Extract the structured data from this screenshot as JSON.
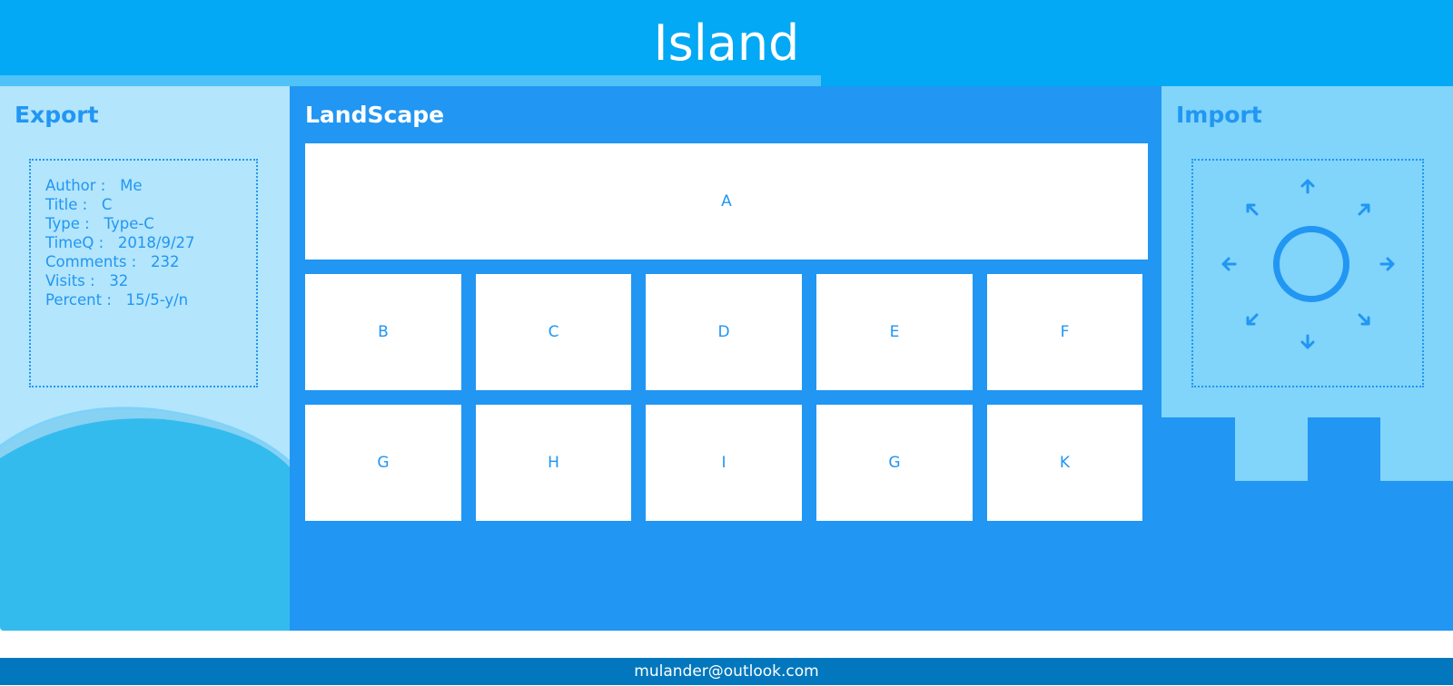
{
  "header": {
    "title": "Island"
  },
  "export": {
    "title": "Export",
    "info": [
      {
        "key": "Author",
        "value": "Me"
      },
      {
        "key": "Title",
        "value": "C"
      },
      {
        "key": "Type",
        "value": "Type-C"
      },
      {
        "key": "TimeQ",
        "value": "2018/9/27"
      },
      {
        "key": "Comments",
        "value": "232"
      },
      {
        "key": "Visits",
        "value": "32"
      },
      {
        "key": "Percent",
        "value": "15/5-y/n"
      }
    ]
  },
  "landscape": {
    "title": "LandScape",
    "tiles": [
      "A",
      "B",
      "C",
      "D",
      "E",
      "F",
      "G",
      "H",
      "I",
      "G",
      "K"
    ]
  },
  "import": {
    "title": "Import",
    "icons": [
      "arrow-up-icon",
      "arrow-up-left-icon",
      "arrow-up-right-icon",
      "arrow-left-icon",
      "circle-icon",
      "arrow-right-icon",
      "arrow-down-left-icon",
      "arrow-down-right-icon",
      "arrow-down-icon"
    ]
  },
  "footer": {
    "email": "mulander@outlook.com"
  },
  "colors": {
    "header": "#03a9f4",
    "accent": "#2196f3",
    "left_bg": "#b3e5fc",
    "right_bg": "#81d4fa",
    "footer": "#0277bd"
  }
}
